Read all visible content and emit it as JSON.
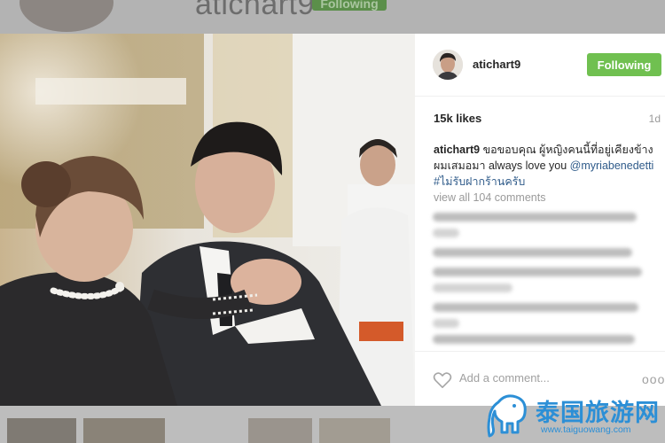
{
  "background": {
    "username": "atichart9",
    "follow_label": "Following"
  },
  "post": {
    "username": "atichart9",
    "follow_label": "Following",
    "likes": "15k likes",
    "time": "1d",
    "caption": {
      "user": "atichart9",
      "text": " ขอขอบคุณ ผู้หญิงคนนี้ที่อยู่เคียงข้างผมเสมอมา always love you ",
      "mention": "@myriabenedetti",
      "hashtag": "#ไม่รับฝากร้านครับ"
    },
    "view_all": "view all 104 comments",
    "comment_placeholder": "Add a comment...",
    "more": "ooo"
  },
  "watermark": {
    "title": "泰国旅游网",
    "url": "www.taiguowang.com"
  },
  "colors": {
    "follow": "#70c050",
    "link": "#2f5b8a",
    "watermark": "#2c8fd6"
  },
  "icons": [
    "heart-icon",
    "more-options-icon",
    "elephant-logo-icon"
  ]
}
